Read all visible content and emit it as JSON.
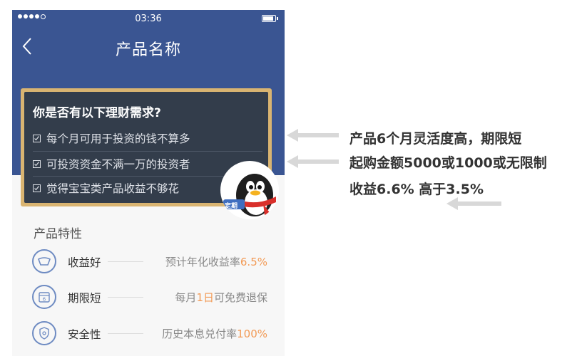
{
  "status_bar": {
    "time": "03:36"
  },
  "nav": {
    "title": "产品名称"
  },
  "board": {
    "question": "你是否有以下理财需求?",
    "items": [
      "每个月可用于投资的钱不算多",
      "可投资资金不满一万的投资者",
      "觉得宝宝类产品收益不够花"
    ]
  },
  "mascot": {
    "badge": "定期"
  },
  "features": {
    "title": "产品特性",
    "items": [
      {
        "label": "收益好",
        "desc_prefix": "预计年化收益率",
        "desc_highlight": "6.5%",
        "desc_suffix": "",
        "icon": "gold-ingot-icon"
      },
      {
        "label": "期限短",
        "desc_prefix": "每月",
        "desc_highlight": "1日",
        "desc_suffix": "可免费退保",
        "icon": "calendar-icon"
      },
      {
        "label": "安全性",
        "desc_prefix": "历史本息兑付率",
        "desc_highlight": "100%",
        "desc_suffix": "",
        "icon": "shield-icon"
      }
    ]
  },
  "annotations": [
    "产品6个月灵活度高，期限短",
    "起购金额5000或1000或无限制",
    "收益6.6% 高于3.5%"
  ],
  "colors": {
    "nav_blue": "#3a5592",
    "board_bg": "#333d4b",
    "board_frame": "#d9b471",
    "highlight_orange": "#f29a55",
    "icon_blue": "#6e8bc2"
  }
}
